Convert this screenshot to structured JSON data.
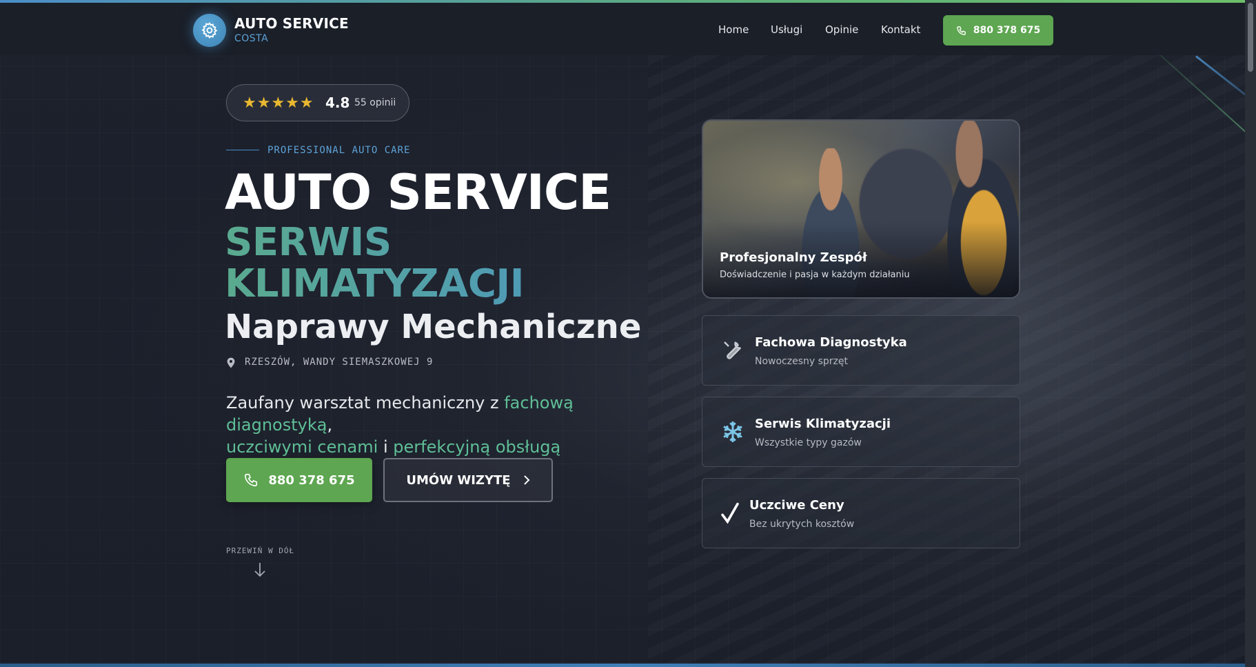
{
  "header": {
    "brand_title": "AUTO SERVICE",
    "brand_subtitle": "COSTA",
    "nav": [
      "Home",
      "Usługi",
      "Opinie",
      "Kontakt"
    ],
    "cta_phone": "880 378 675"
  },
  "rating": {
    "stars": "★★★★★",
    "value": "4.8",
    "count": "55 opinii"
  },
  "hero": {
    "tagline": "PROFESSIONAL AUTO CARE",
    "title_line1": "AUTO SERVICE",
    "title_line2a": "SERWIS",
    "title_line2b": "KLIMATYZACJI",
    "title_line3": "Naprawy Mechaniczne",
    "address": "RZESZÓW, WANDY SIEMASZKOWEJ 9",
    "lead": {
      "part1": "Zaufany warsztat mechaniczny z ",
      "hl1": "fachową diagnostyką",
      "part2": ",",
      "hl2": "uczciwymi cenami",
      "part3": " i ",
      "hl3": "perfekcyjną obsługą"
    },
    "btn_phone": "880 378 675",
    "btn_visit": "UMÓW WIZYTĘ",
    "scroll_hint": "PRZEWIŃ W DÓŁ"
  },
  "team_card": {
    "title": "Profesjonalny Zespół",
    "subtitle": "Doświadczenie i pasja w każdym działaniu"
  },
  "features": [
    {
      "icon": "wrench-icon",
      "title": "Fachowa Diagnostyka",
      "subtitle": "Nowoczesny sprzęt"
    },
    {
      "icon": "snowflake-icon",
      "title": "Serwis Klimatyzacji",
      "subtitle": "Wszystkie typy gazów"
    },
    {
      "icon": "checkmark-icon",
      "title": "Uczciwe Ceny",
      "subtitle": "Bez ukrytych kosztów"
    }
  ],
  "colors": {
    "accent_green": "#5ea651",
    "accent_blue": "#4a8dc7",
    "highlight_teal": "#5fbf96",
    "star_yellow": "#e8b830"
  }
}
